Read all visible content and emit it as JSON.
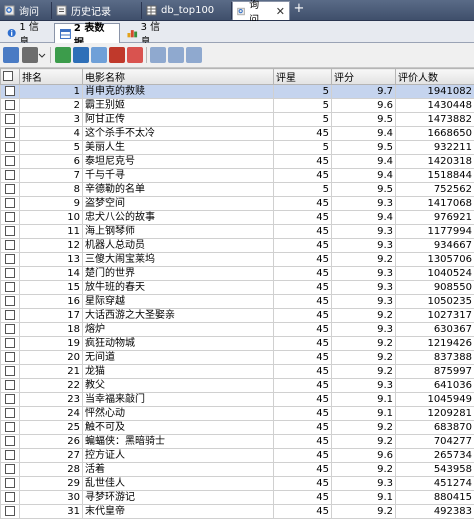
{
  "doc_tabs": [
    {
      "label": "询问",
      "icon": "query-icon"
    },
    {
      "label": "历史记录",
      "icon": "history-icon"
    },
    {
      "label": "db_top100",
      "icon": "table-icon"
    },
    {
      "label": "询问",
      "icon": "query-icon",
      "active": true
    }
  ],
  "sub_tabs": [
    {
      "label": "1 信息",
      "icon": "info-icon"
    },
    {
      "label": "2 表数据",
      "icon": "table-data-icon",
      "active": true
    },
    {
      "label": "3 信息",
      "icon": "info-chart-icon"
    }
  ],
  "columns": [
    "",
    "排名",
    "电影名称",
    "评星",
    "评分",
    "评价人数"
  ],
  "rows": [
    {
      "rank": "1",
      "title": "肖申克的救赎",
      "stars": "5",
      "score": "9.7",
      "votes": "1941082"
    },
    {
      "rank": "2",
      "title": "霸王别姬",
      "stars": "5",
      "score": "9.6",
      "votes": "1430448"
    },
    {
      "rank": "3",
      "title": "阿甘正传",
      "stars": "5",
      "score": "9.5",
      "votes": "1473882"
    },
    {
      "rank": "4",
      "title": "这个杀手不太冷",
      "stars": "45",
      "score": "9.4",
      "votes": "1668650"
    },
    {
      "rank": "5",
      "title": "美丽人生",
      "stars": "5",
      "score": "9.5",
      "votes": "932211"
    },
    {
      "rank": "6",
      "title": "泰坦尼克号",
      "stars": "45",
      "score": "9.4",
      "votes": "1420318"
    },
    {
      "rank": "7",
      "title": "千与千寻",
      "stars": "45",
      "score": "9.4",
      "votes": "1518844"
    },
    {
      "rank": "8",
      "title": "辛德勒的名单",
      "stars": "5",
      "score": "9.5",
      "votes": "752562"
    },
    {
      "rank": "9",
      "title": "盗梦空间",
      "stars": "45",
      "score": "9.3",
      "votes": "1417068"
    },
    {
      "rank": "10",
      "title": "忠犬八公的故事",
      "stars": "45",
      "score": "9.4",
      "votes": "976921"
    },
    {
      "rank": "11",
      "title": "海上钢琴师",
      "stars": "45",
      "score": "9.3",
      "votes": "1177994"
    },
    {
      "rank": "12",
      "title": "机器人总动员",
      "stars": "45",
      "score": "9.3",
      "votes": "934667"
    },
    {
      "rank": "13",
      "title": "三傻大闹宝莱坞",
      "stars": "45",
      "score": "9.2",
      "votes": "1305706"
    },
    {
      "rank": "14",
      "title": "楚门的世界",
      "stars": "45",
      "score": "9.3",
      "votes": "1040524"
    },
    {
      "rank": "15",
      "title": "放牛班的春天",
      "stars": "45",
      "score": "9.3",
      "votes": "908550"
    },
    {
      "rank": "16",
      "title": "星际穿越",
      "stars": "45",
      "score": "9.3",
      "votes": "1050235"
    },
    {
      "rank": "17",
      "title": "大话西游之大圣娶亲",
      "stars": "45",
      "score": "9.2",
      "votes": "1027317"
    },
    {
      "rank": "18",
      "title": "熔炉",
      "stars": "45",
      "score": "9.3",
      "votes": "630367"
    },
    {
      "rank": "19",
      "title": "疯狂动物城",
      "stars": "45",
      "score": "9.2",
      "votes": "1219426"
    },
    {
      "rank": "20",
      "title": "无间道",
      "stars": "45",
      "score": "9.2",
      "votes": "837388"
    },
    {
      "rank": "21",
      "title": "龙猫",
      "stars": "45",
      "score": "9.2",
      "votes": "875997"
    },
    {
      "rank": "22",
      "title": "教父",
      "stars": "45",
      "score": "9.3",
      "votes": "641036"
    },
    {
      "rank": "23",
      "title": "当幸福来敲门",
      "stars": "45",
      "score": "9.1",
      "votes": "1045949"
    },
    {
      "rank": "24",
      "title": "怦然心动",
      "stars": "45",
      "score": "9.1",
      "votes": "1209281"
    },
    {
      "rank": "25",
      "title": "触不可及",
      "stars": "45",
      "score": "9.2",
      "votes": "683870"
    },
    {
      "rank": "26",
      "title": "蝙蝠侠：黑暗骑士",
      "stars": "45",
      "score": "9.2",
      "votes": "704277"
    },
    {
      "rank": "27",
      "title": "控方证人",
      "stars": "45",
      "score": "9.6",
      "votes": "265734"
    },
    {
      "rank": "28",
      "title": "活着",
      "stars": "45",
      "score": "9.2",
      "votes": "543958"
    },
    {
      "rank": "29",
      "title": "乱世佳人",
      "stars": "45",
      "score": "9.3",
      "votes": "451274"
    },
    {
      "rank": "30",
      "title": "寻梦环游记",
      "stars": "45",
      "score": "9.1",
      "votes": "880415"
    },
    {
      "rank": "31",
      "title": "末代皇帝",
      "stars": "45",
      "score": "9.2",
      "votes": "492383"
    }
  ],
  "colors": {
    "title_bar": "#4a5a78",
    "selection": "#c5d4ee"
  }
}
